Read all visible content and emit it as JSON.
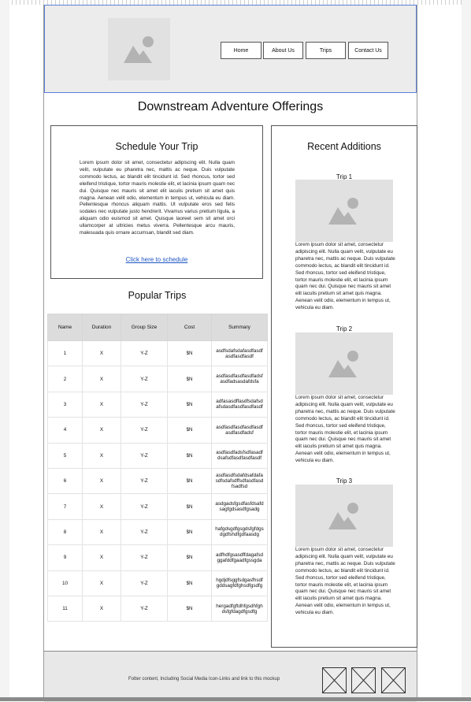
{
  "header": {
    "nav": [
      "Home",
      "About Us",
      "Trips",
      "Contact Us"
    ]
  },
  "page_title": "Downstream Adventure Offerings",
  "schedule": {
    "title": "Schedule Your Trip",
    "body": "Lorem ipsum dolor sit amet, consectetur adipiscing elit. Nulla quam velit, vulputate eu pharetra nec, mattis ac neque. Duis vulputate commodo lectus, ac blandit elit tincidunt id. Sed rhoncus, tortor sed eleifend tristique, tortor mauris molestie elit, et lacinia ipsum quam nec dui. Quisque nec mauris sit amet elit iaculis pretium sit amet quis magna. Aenean velit odio, elementum in tempus ut, vehicula eu diam. Pellentesque rhoncus aliquam mattis. Ut vulputate eros sed felis sodales nec vulputate justo hendrerit. Vivamus varius pretium ligula, a aliquam odio euismod sit amet. Quisque laoreet sem sit amet orci ullamcorper at ultricies metus viverra. Pellentesque arcu mauris, malesuada quis ornare accumsan, blandit sed diam.",
    "link": "Click here to schedule"
  },
  "popular": {
    "title": "Popular Trips",
    "columns": [
      "Name",
      "Duration",
      "Group Size",
      "Cost",
      "Summary"
    ],
    "rows": [
      {
        "name": "1",
        "duration": "X",
        "group": "Y-Z",
        "cost": "$N",
        "summary": "asdfsdafsdafasdfasdfasdfasdfasdf"
      },
      {
        "name": "2",
        "duration": "X",
        "group": "Y-Z",
        "cost": "$N",
        "summary": "asdfasdfasdfasdfadsfasdfadsasdafdsfa"
      },
      {
        "name": "3",
        "duration": "X",
        "group": "Y-Z",
        "cost": "$N",
        "summary": "adfasasdffasdfsdafsdafsdasdfasdfasdfasdf"
      },
      {
        "name": "4",
        "duration": "X",
        "group": "Y-Z",
        "cost": "$N",
        "summary": "asdfasdfasdfasdfasdfasdfasdfadsf"
      },
      {
        "name": "5",
        "duration": "X",
        "group": "Y-Z",
        "cost": "$N",
        "summary": "asdfasdfadsfsdfasadfdsafsdfasdfasdfasdf"
      },
      {
        "name": "6",
        "duration": "X",
        "group": "Y-Z",
        "cost": "$N",
        "summary": "asdfasdfsdafdsafdafasdfsdafsdffsdfasdfasdfsadfsd"
      },
      {
        "name": "7",
        "duration": "X",
        "group": "Y-Z",
        "cost": "$N",
        "summary": "asdgadsfgsdfasfdsafdsagfgdsasdfgsadg"
      },
      {
        "name": "8",
        "duration": "X",
        "group": "Y-Z",
        "cost": "$N",
        "summary": "hafgdsgdfgsgdsfgfdgsdgdfshdfgdfaasdg"
      },
      {
        "name": "9",
        "duration": "X",
        "group": "Y-Z",
        "cost": "$N",
        "summary": "adfhdfgsasdffdagafsdggafddfgaadfgssgda"
      },
      {
        "name": "10",
        "duration": "X",
        "group": "Y-Z",
        "cost": "$N",
        "summary": "hgdjdfsggfsdgasfhsdfgddsagfdfghsdfgsdfg"
      },
      {
        "name": "11",
        "duration": "X",
        "group": "Y-Z",
        "cost": "$N",
        "summary": "hergadfgftdhfgsdhfghdsfgfdagdfgsdfg"
      }
    ]
  },
  "recent": {
    "title": "Recent Additions",
    "trips": [
      {
        "label": "Trip 1",
        "text": "Lorem ipsum dolor sit amet, consectetur adipiscing elit. Nulla quam velit, vulputate eu pharetra nec, mattis ac neque. Duis vulputate commodo lectus, ac blandit elit tincidunt id. Sed rhoncus, tortor sed eleifend tristique, tortor mauris molestie elit, et lacinia ipsum quam nec dui. Quisque nec mauris sit amet elit iaculis pretium sit amet quis magna. Aenean velit odio, elementum in tempus ut, vehicula eu diam."
      },
      {
        "label": "Trip 2",
        "text": "Lorem ipsum dolor sit amet, consectetur adipiscing elit. Nulla quam velit, vulputate eu pharetra nec, mattis ac neque. Duis vulputate commodo lectus, ac blandit elit tincidunt id. Sed rhoncus, tortor sed eleifend tristique, tortor mauris molestie elit, et lacinia ipsum quam nec dui. Quisque nec mauris sit amet elit iaculis pretium sit amet quis magna. Aenean velit odio, elementum in tempus ut, vehicula eu diam."
      },
      {
        "label": "Trip 3",
        "text": "Lorem ipsum dolor sit amet, consectetur adipiscing elit. Nulla quam velit, vulputate eu pharetra nec, mattis ac neque. Duis vulputate commodo lectus, ac blandit elit tincidunt id. Sed rhoncus, tortor sed eleifend tristique, tortor mauris molestie elit, et lacinia ipsum quam nec dui. Quisque nec mauris sit amet elit iaculis pretium sit amet quis magna. Aenean velit odio, elementum in tempus ut, vehicula eu diam."
      }
    ]
  },
  "footer": {
    "text": "Fotter content, Including Social Media Icon-Links and link to this mockup"
  }
}
